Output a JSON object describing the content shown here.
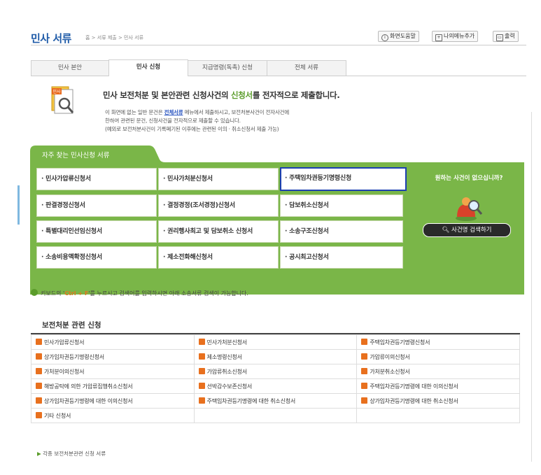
{
  "header": {
    "title": "민사 서류",
    "breadcrumb": "홈 > 서류 제출 > 민사 서류",
    "help_button": "화면도움말",
    "mymenu_button": "나의메뉴추가",
    "print_button": "출력"
  },
  "tabs": [
    {
      "label": "민사 본안"
    },
    {
      "label": "민사 신청",
      "active": true
    },
    {
      "label": "지급명령(독촉) 신청"
    },
    {
      "label": "전체 서류"
    }
  ],
  "intro": {
    "icon_label": "민사",
    "title_pre": "민사 보전처분 및 본안관련 신청사건의 ",
    "title_highlight": "신청서",
    "title_post": "를 전자적으로 제출합니다.",
    "line1_pre": "이 화면에 없는 일반 문건은 ",
    "line1_link": "전체서류",
    "line1_post": " 메뉴에서 제출하시고, 보전처분사건이 전자사건에",
    "line2": "한하여 관련된 문건, 신청사건을 전자적으로 제출할 수 있습니다.",
    "line3": "(예외로 보전처분사건이 기록폐기된 이후에는 관련된 이의 · 취소신청서 제출 가능)"
  },
  "frequent": {
    "title": "자주 찾는 민사신청 서류",
    "items": [
      "· 민사가압류신청서",
      "· 민사가처분신청서",
      "· 주택임차권등기명령신청",
      "· 판결경정신청서",
      "· 결정경정(조서경정)신청서",
      "· 담보취소신청서",
      "· 특별대리인선임신청서",
      "· 권리행사최고 및 담보취소 신청서",
      "· 소송구조신청서",
      "· 소송비용액확정신청서",
      "· 제소전화해신청서",
      "· 공시최고신청서"
    ],
    "selected_index": 2,
    "side_question": "원하는 사건이 없으십니까?",
    "search_button": "사건명 검색하기"
  },
  "hint": {
    "pre": "키보드의 '",
    "key": "Ctrl + F",
    "post": "'를 누르시고 검색어를 입력하시면 아래 소송서류 검색이 가능합니다."
  },
  "section": {
    "title": "보전처분 관련 신청",
    "rows": [
      [
        "민사가압류신청서",
        "민사가처분신청서",
        "주택임차권등기명령신청서"
      ],
      [
        "상가임차권등기명령신청서",
        "제소명령신청서",
        "가압류이의신청서"
      ],
      [
        "가처분이의신청서",
        "가압류취소신청서",
        "가처분취소신청서"
      ],
      [
        "해방공탁에 의한 가압류집행취소신청서",
        "선박감수보존신청서",
        "주택임차권등기명령에 대한 이의신청서"
      ],
      [
        "상가임차권등기명령에 대한 이의신청서",
        "주택임차권등기명령에 대한 취소신청서",
        "상가임차권등기명령에 대한 취소신청서"
      ],
      [
        "기타 신청서",
        "",
        ""
      ]
    ]
  },
  "footer_link": "각종 보전처분관련 신청 서류",
  "colors": {
    "green": "#7ab648",
    "title_blue": "#1f5ba8",
    "bullet_orange": "#e8701e",
    "selected_border": "#1c3fb0"
  }
}
